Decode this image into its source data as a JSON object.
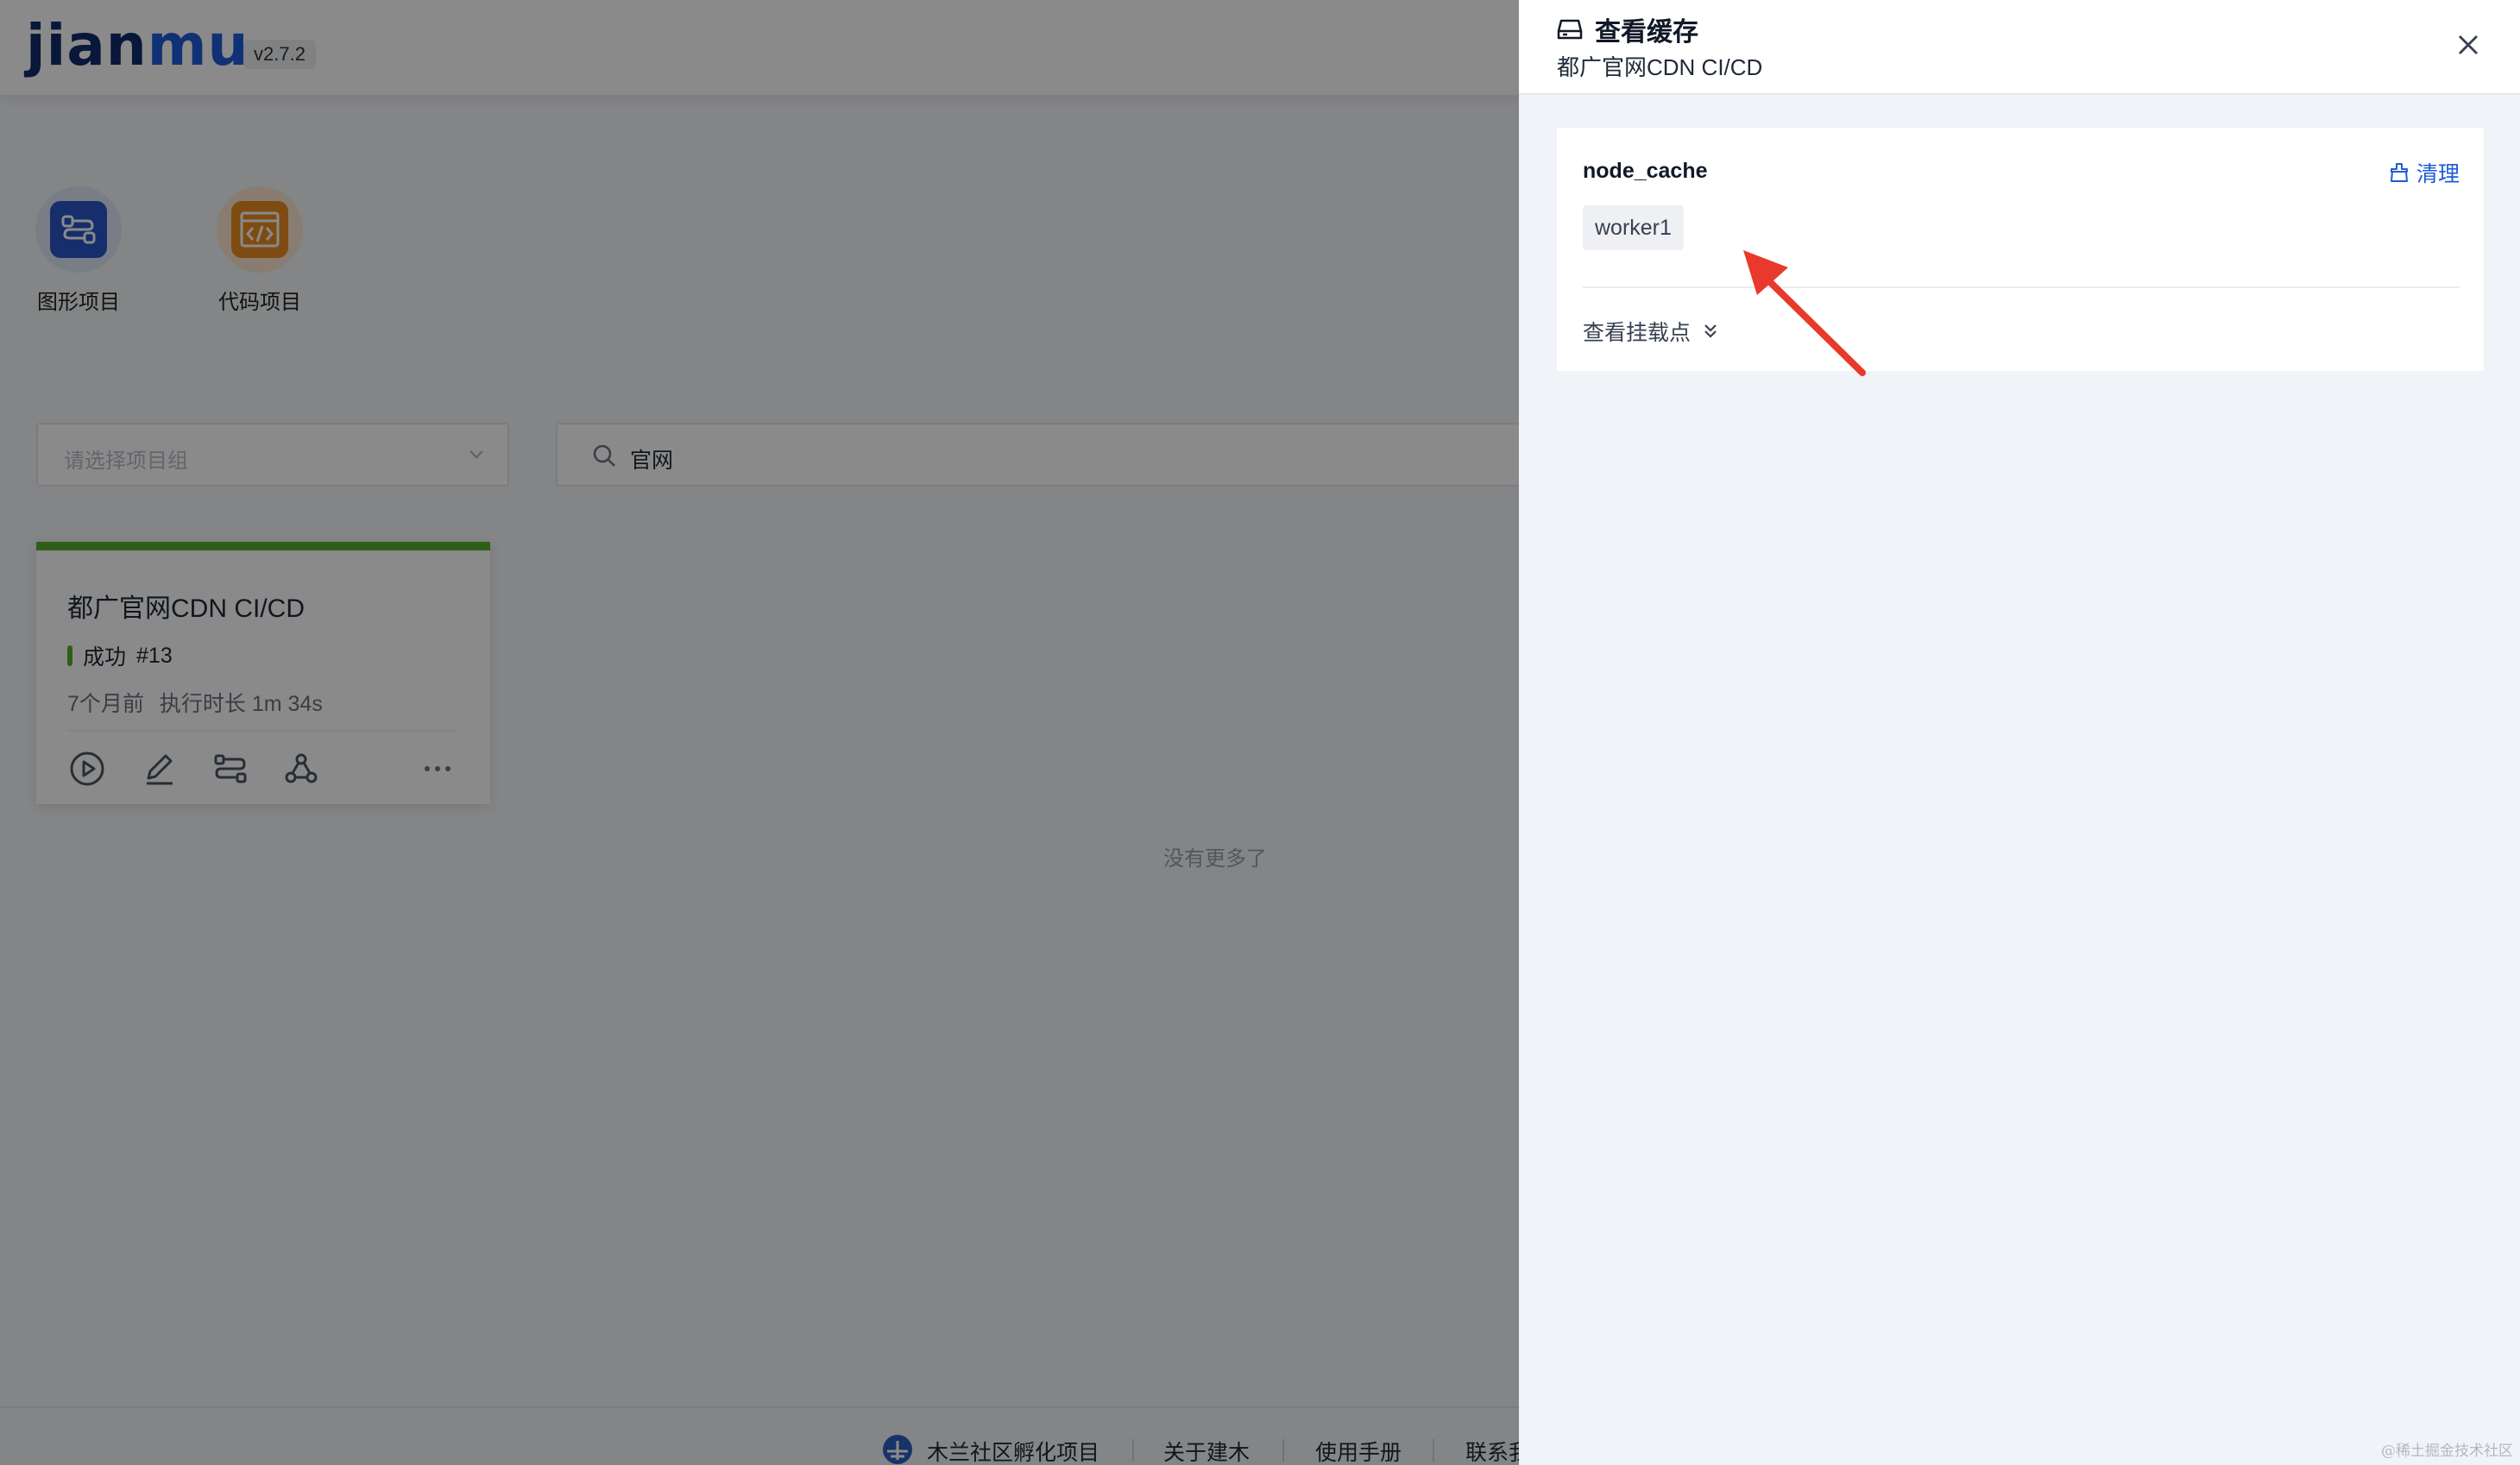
{
  "app": {
    "logo_prefix": "jian",
    "logo_accent": "mu",
    "version": "v2.7.2"
  },
  "entries": [
    {
      "label": "图形项目",
      "icon": "workflow-graph-icon"
    },
    {
      "label": "代码项目",
      "icon": "code-icon"
    }
  ],
  "filters": {
    "group_placeholder": "请选择项目组",
    "search_value": "官网"
  },
  "project_card": {
    "title": "都广官网CDN CI/CD",
    "status": "成功",
    "build_number": "#13",
    "time_ago": "7个月前",
    "duration": "执行时长 1m 34s",
    "status_color": "#53b02e",
    "actions": [
      "play-icon",
      "edit-icon",
      "workflow-icon",
      "webhook-icon",
      "more-icon"
    ]
  },
  "list_end_text": "没有更多了",
  "footer": {
    "links": [
      "木兰社区孵化项目",
      "关于建木",
      "使用手册",
      "联系我"
    ]
  },
  "drawer": {
    "title": "查看缓存",
    "subtitle": "都广官网CDN CI/CD",
    "cache": {
      "name": "node_cache",
      "clean_label": "清理",
      "worker": "worker1",
      "mount_label": "查看挂载点"
    }
  },
  "colors": {
    "accent": "#1e5bd8",
    "success": "#53b02e",
    "annotation_arrow": "#e8392c"
  },
  "watermark": "@稀土掘金技术社区"
}
